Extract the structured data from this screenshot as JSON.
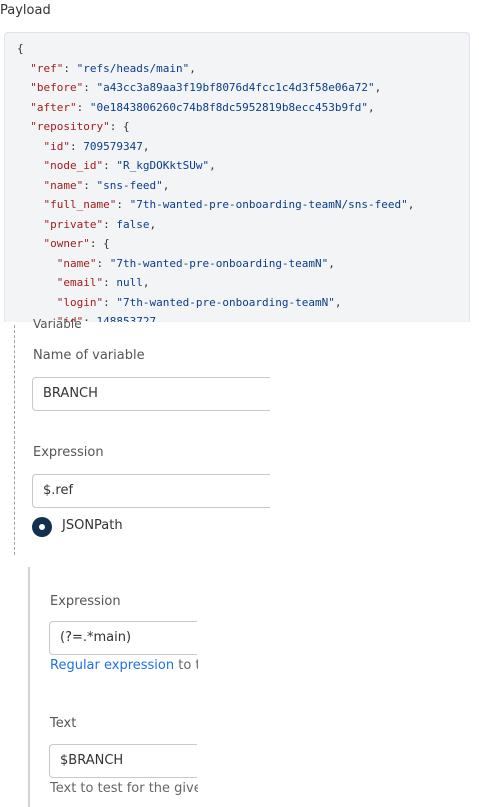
{
  "payload": {
    "title": "Payload",
    "lines": [
      {
        "indent": 0,
        "key": "",
        "value": "",
        "raw": "{"
      },
      {
        "indent": 1,
        "key": "\"ref\"",
        "value": "\"refs/heads/main\"",
        "suffix": ","
      },
      {
        "indent": 1,
        "key": "\"before\"",
        "value": "\"a43cc3a89aa3f19bf8076d4fcc1c4d3f58e06a72\"",
        "suffix": ","
      },
      {
        "indent": 1,
        "key": "\"after\"",
        "value": "\"0e1843806260c74b8f8dc5952819b8ecc453b9fd\"",
        "suffix": ","
      },
      {
        "indent": 1,
        "key": "\"repository\"",
        "value": "",
        "suffix": "{"
      },
      {
        "indent": 2,
        "key": "\"id\"",
        "value": "709579347",
        "suffix": ","
      },
      {
        "indent": 2,
        "key": "\"node_id\"",
        "value": "\"R_kgDOKktSUw\"",
        "suffix": ","
      },
      {
        "indent": 2,
        "key": "\"name\"",
        "value": "\"sns-feed\"",
        "suffix": ","
      },
      {
        "indent": 2,
        "key": "\"full_name\"",
        "value": "\"7th-wanted-pre-onboarding-teamN/sns-feed\"",
        "suffix": ","
      },
      {
        "indent": 2,
        "key": "\"private\"",
        "value": "false",
        "suffix": ","
      },
      {
        "indent": 2,
        "key": "\"owner\"",
        "value": "",
        "suffix": "{"
      },
      {
        "indent": 3,
        "key": "\"name\"",
        "value": "\"7th-wanted-pre-onboarding-teamN\"",
        "suffix": ","
      },
      {
        "indent": 3,
        "key": "\"email\"",
        "value": "null",
        "suffix": ","
      },
      {
        "indent": 3,
        "key": "\"login\"",
        "value": "\"7th-wanted-pre-onboarding-teamN\"",
        "suffix": ","
      },
      {
        "indent": 3,
        "key": "\"id\"",
        "value": "148853727",
        "suffix": ""
      }
    ]
  },
  "variable": {
    "section_label": "Variable",
    "name_label": "Name of variable",
    "name_value": "BRANCH",
    "expression_label": "Expression",
    "expression_value": "$.ref",
    "radio_label": "JSONPath"
  },
  "filter": {
    "expression_label": "Expression",
    "expression_value": "(?=.*main)",
    "help_link": "Regular expression",
    "help_rest": " to t",
    "text_label": "Text",
    "text_value": "$BRANCH",
    "text_help": "Text to test for the give"
  }
}
